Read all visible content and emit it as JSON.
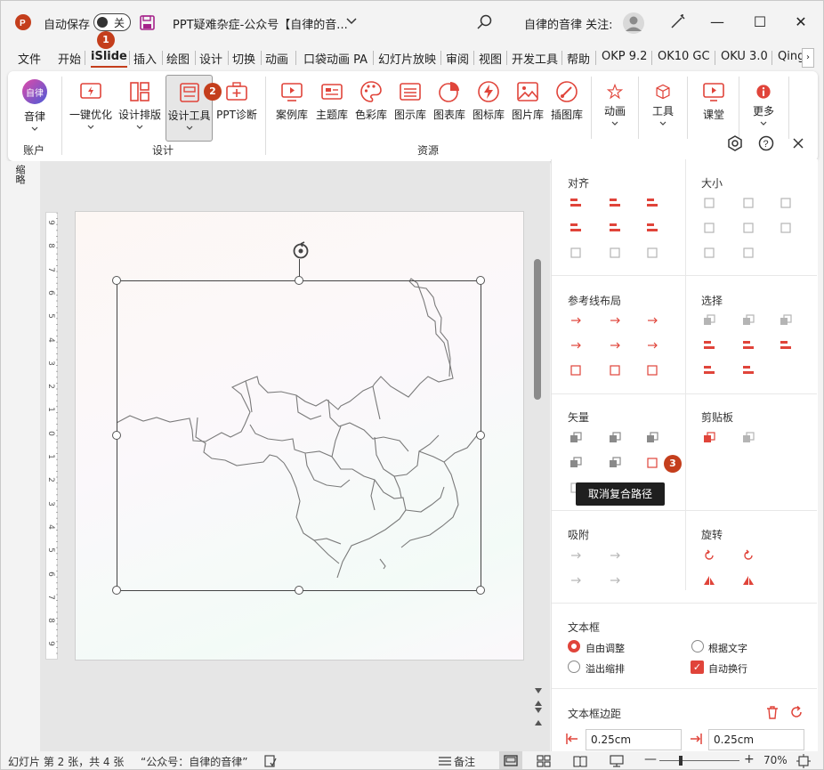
{
  "titlebar": {
    "autosave_label": "自动保存",
    "autosave_state": "关",
    "doc_title": "PPT疑难杂症-公众号【自律的音...",
    "user_label": "自律的音律 关注:",
    "accent": "#c43e1c"
  },
  "tabs": [
    {
      "label": "文件"
    },
    {
      "label": "开始"
    },
    {
      "label": "iSlide"
    },
    {
      "label": "插入"
    },
    {
      "label": "绘图"
    },
    {
      "label": "设计"
    },
    {
      "label": "切换"
    },
    {
      "label": "动画"
    },
    {
      "label": "口袋动画 PA"
    },
    {
      "label": "幻灯片放映"
    },
    {
      "label": "审阅"
    },
    {
      "label": "视图"
    },
    {
      "label": "开发工具"
    },
    {
      "label": "帮助"
    },
    {
      "label": "OKP 9.2"
    },
    {
      "label": "OK10 GC"
    },
    {
      "label": "OKU 3.0"
    },
    {
      "label": "Qing"
    }
  ],
  "ribbon": {
    "account": {
      "label": "音律",
      "avatar_text": "自律",
      "group": "账户"
    },
    "design": {
      "group": "设计",
      "buttons": [
        {
          "label": "一键优化"
        },
        {
          "label": "设计排版"
        },
        {
          "label": "设计工具"
        },
        {
          "label": "PPT诊断"
        }
      ]
    },
    "resources": {
      "group": "资源",
      "buttons": [
        {
          "label": "案例库"
        },
        {
          "label": "主题库"
        },
        {
          "label": "色彩库"
        },
        {
          "label": "图示库"
        },
        {
          "label": "图表库"
        },
        {
          "label": "图标库"
        },
        {
          "label": "图片库"
        },
        {
          "label": "插图库"
        }
      ]
    },
    "extra": [
      {
        "label": "动画"
      },
      {
        "label": "工具"
      },
      {
        "label": "课堂"
      },
      {
        "label": "更多"
      }
    ]
  },
  "badges": {
    "one": "1",
    "two": "2",
    "three": "3"
  },
  "left_label": "缩略",
  "ruler_numbers": [
    "9",
    "8",
    "7",
    "6",
    "5",
    "4",
    "3",
    "2",
    "1",
    "0",
    "1",
    "2",
    "3",
    "4",
    "5",
    "6",
    "7",
    "8",
    "9"
  ],
  "pane": {
    "align": "对齐",
    "size": "大小",
    "guides": "参考线布局",
    "select": "选择",
    "vector": "矢量",
    "clipboard": "剪贴板",
    "snap": "吸附",
    "rotate": "旋转",
    "tooltip": "取消复合路径",
    "textbox": {
      "title": "文本框",
      "options": {
        "free": "自由调整",
        "fit": "根据文字",
        "overflow": "溢出缩排",
        "wrap": "自动换行"
      }
    },
    "margins": {
      "title": "文本框边距",
      "left_value": "0.25cm",
      "right_value": "0.25cm"
    }
  },
  "status": {
    "slide_info": "幻灯片 第 2 张，共 4 张",
    "note": "“公众号：自律的音律”",
    "notes_label": "备注",
    "zoom": "70%"
  }
}
